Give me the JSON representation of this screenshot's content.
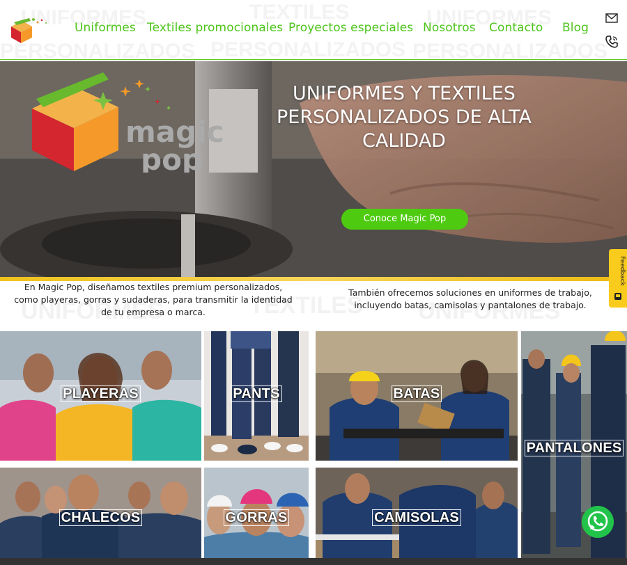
{
  "header": {
    "watermark": [
      "UNIFORMES",
      "TEXTILES",
      "UNIFORMES",
      "PERSONALIZADOS",
      "PERSONALIZADOS",
      "PERSONALIZADOS"
    ],
    "nav": [
      {
        "label": "Uniformes"
      },
      {
        "label": "Textiles promocionales"
      },
      {
        "label": "Proyectos especiales"
      },
      {
        "label": "Nosotros"
      },
      {
        "label": "Contacto"
      },
      {
        "label": "Blog"
      }
    ],
    "icons": [
      "mail-icon",
      "phone-icon"
    ]
  },
  "hero": {
    "logo_text": [
      "magic",
      "pop"
    ],
    "title_lines": [
      "UNIFORMES Y TEXTILES",
      "PERSONALIZADOS DE ALTA",
      "CALIDAD"
    ],
    "cta_label": "Conoce Magic Pop"
  },
  "intro": {
    "watermark": [
      "UNIFORMES",
      "TEXTILES",
      "UNIFORMES"
    ],
    "left": "En Magic Pop, diseñamos textiles premium personalizados, como playeras, gorras y sudaderas, para transmitir la identidad de tu empresa o marca.",
    "right": "También ofrecemos soluciones en uniformes de trabajo, incluyendo batas, camisolas y pantalones de trabajo."
  },
  "tiles": [
    {
      "label": "PLAYERAS"
    },
    {
      "label": "PANTS"
    },
    {
      "label": "BATAS"
    },
    {
      "label": "PANTALONES"
    },
    {
      "label": "CHALECOS"
    },
    {
      "label": "GORRAS"
    },
    {
      "label": "CAMISOLAS"
    }
  ],
  "feedback": {
    "label": "Feedback"
  },
  "colors": {
    "brand_green": "#4ec41a",
    "accent_yellow": "#f1c21c",
    "logo_red": "#d3262f",
    "logo_orange": "#f59a2a",
    "whatsapp": "#22c34a"
  }
}
